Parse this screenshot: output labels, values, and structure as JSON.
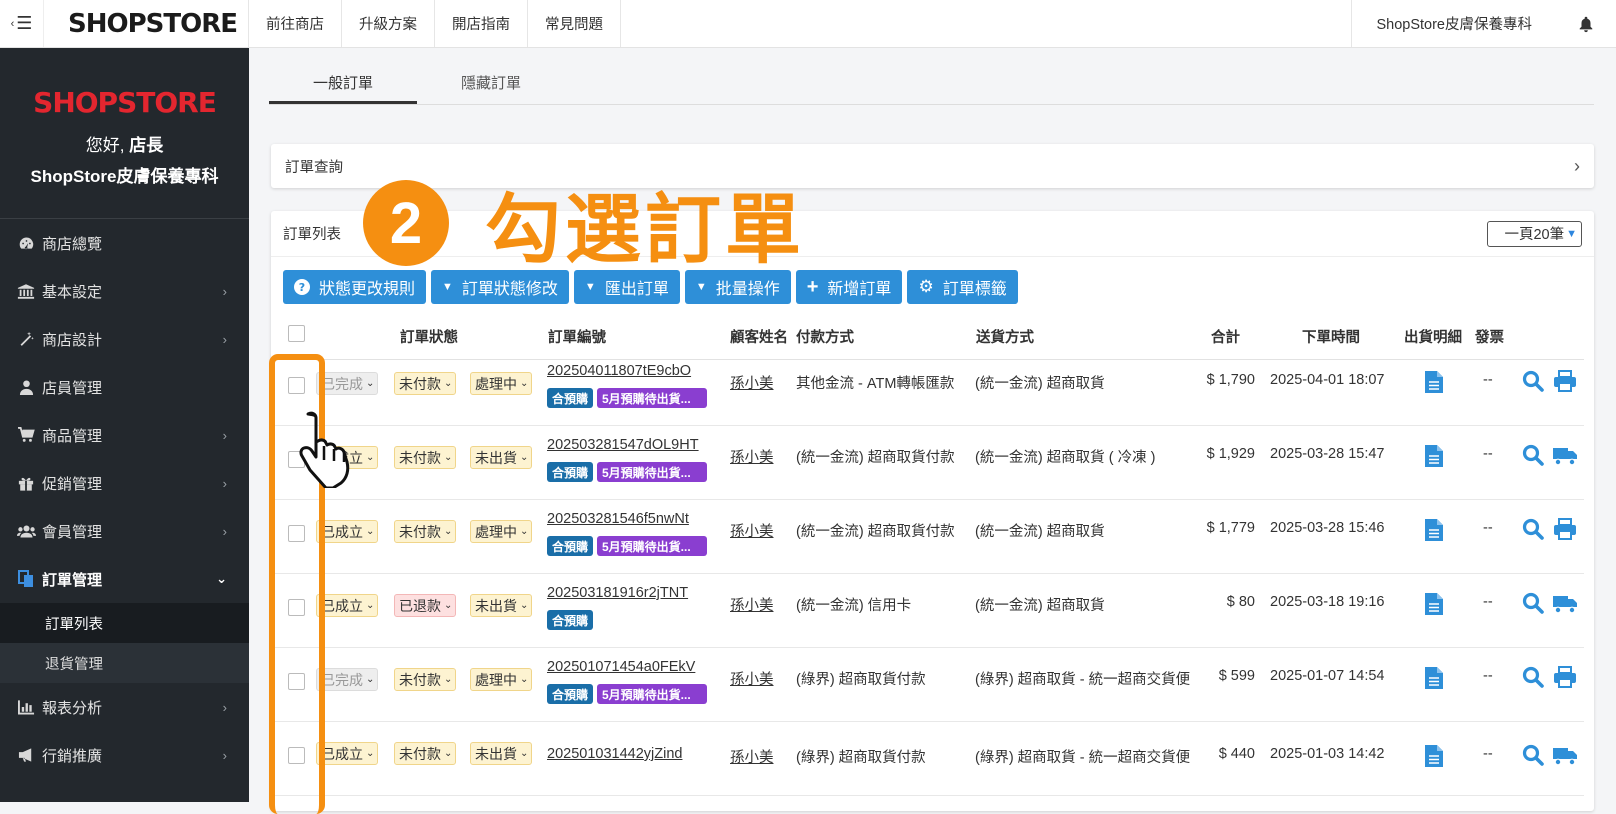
{
  "topbar": {
    "logo": "SHOPSTORE",
    "links": [
      "前往商店",
      "升級方案",
      "開店指南",
      "常見問題"
    ],
    "store_name": "ShopStore皮膚保養專科"
  },
  "sidebar": {
    "logo": "SHOPSTORE",
    "greeting_prefix": "您好,",
    "greeting_role": "店長",
    "store_name": "ShopStore皮膚保養專科",
    "items": [
      {
        "label": "商店總覽",
        "icon": "dashboard-icon"
      },
      {
        "label": "基本設定",
        "icon": "bank-icon"
      },
      {
        "label": "商店設計",
        "icon": "magic-wand-icon"
      },
      {
        "label": "店員管理",
        "icon": "staff-icon"
      },
      {
        "label": "商品管理",
        "icon": "cart-icon"
      },
      {
        "label": "促銷管理",
        "icon": "gift-icon"
      },
      {
        "label": "會員管理",
        "icon": "users-icon"
      },
      {
        "label": "訂單管理",
        "icon": "copy-icon"
      },
      {
        "label": "報表分析",
        "icon": "bar-chart-icon"
      },
      {
        "label": "行銷推廣",
        "icon": "bullhorn-icon"
      }
    ],
    "sub_items": [
      "訂單列表",
      "退貨管理"
    ]
  },
  "tabs": [
    "一般訂單",
    "隱藏訂單"
  ],
  "search_panel": {
    "title": "訂單查詢"
  },
  "list_panel": {
    "title": "訂單列表",
    "per_page": "一頁20筆",
    "buttons": [
      "狀態更改規則",
      "訂單狀態修改",
      "匯出訂單",
      "批量操作",
      "新增訂單",
      "訂單標籤"
    ]
  },
  "table": {
    "headers": [
      "訂單狀態",
      "訂單編號",
      "顧客姓名",
      "付款方式",
      "送貨方式",
      "合計",
      "下單時間",
      "出貨明細",
      "發票"
    ],
    "rows": [
      {
        "status": "已完成",
        "pay_status": "未付款",
        "ship_status": "處理中",
        "order_no": "202504011807tE9cbO",
        "badges": [
          "合預購",
          "5月預購待出貨..."
        ],
        "customer": "孫小美",
        "payment": "其他金流 - ATM轉帳匯款",
        "shipping": "(統一金流) 超商取貨",
        "total": "$ 1,790",
        "time": "2025-04-01 18:07",
        "invoice": "--",
        "action": "print"
      },
      {
        "status": "已成立",
        "pay_status": "未付款",
        "ship_status": "未出貨",
        "order_no": "202503281547dOL9HT",
        "badges": [
          "合預購",
          "5月預購待出貨..."
        ],
        "customer": "孫小美",
        "payment": "(統一金流) 超商取貨付款",
        "shipping": "(統一金流) 超商取貨 ( 冷凍 )",
        "total": "$ 1,929",
        "time": "2025-03-28 15:47",
        "invoice": "--",
        "action": "truck"
      },
      {
        "status": "已成立",
        "pay_status": "未付款",
        "ship_status": "處理中",
        "order_no": "202503281546f5nwNt",
        "badges": [
          "合預購",
          "5月預購待出貨..."
        ],
        "customer": "孫小美",
        "payment": "(統一金流) 超商取貨付款",
        "shipping": "(統一金流) 超商取貨",
        "total": "$ 1,779",
        "time": "2025-03-28 15:46",
        "invoice": "--",
        "action": "print"
      },
      {
        "status": "已成立",
        "pay_status": "已退款",
        "ship_status": "未出貨",
        "order_no": "202503181916r2jTNT",
        "badges": [
          "合預購"
        ],
        "customer": "孫小美",
        "payment": "(統一金流) 信用卡",
        "shipping": "(統一金流) 超商取貨",
        "total": "$ 80",
        "time": "2025-03-18 19:16",
        "invoice": "--",
        "action": "truck"
      },
      {
        "status": "已完成",
        "pay_status": "未付款",
        "ship_status": "處理中",
        "order_no": "202501071454a0FEkV",
        "badges": [
          "合預購",
          "5月預購待出貨..."
        ],
        "customer": "孫小美",
        "payment": "(綠界) 超商取貨付款",
        "shipping": "(綠界) 超商取貨 - 統一超商交貨便",
        "total": "$ 599",
        "time": "2025-01-07 14:54",
        "invoice": "--",
        "action": "print"
      },
      {
        "status": "已成立",
        "pay_status": "未付款",
        "ship_status": "未出貨",
        "order_no": "202501031442yjZind",
        "badges": [],
        "customer": "孫小美",
        "payment": "(綠界) 超商取貨付款",
        "shipping": "(綠界) 超商取貨 - 統一超商交貨便",
        "total": "$ 440",
        "time": "2025-01-03 14:42",
        "invoice": "--",
        "action": "truck"
      }
    ]
  },
  "annotation": {
    "number": "2",
    "text": "勾選訂單"
  },
  "colors": {
    "accent": "#2e8fd8",
    "annotation": "#f58f11",
    "sidebar_bg": "#23282d",
    "brand_red": "#e3262f"
  }
}
